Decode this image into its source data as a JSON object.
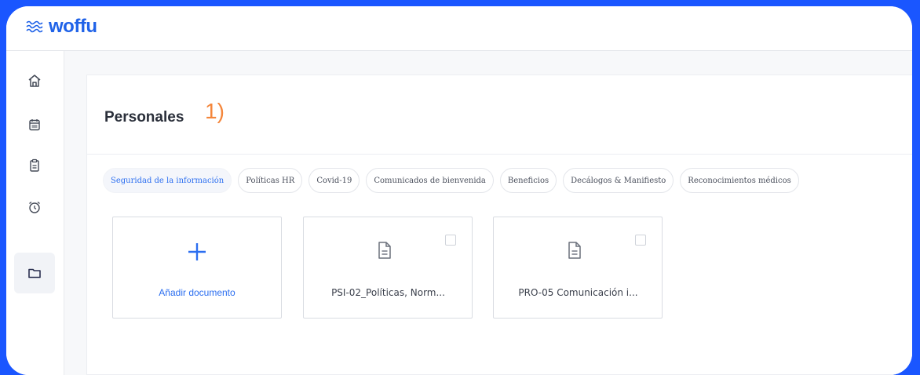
{
  "brand": {
    "logo_text": "woffu",
    "color": "#1f62e8"
  },
  "sidebar": {
    "items": [
      {
        "icon": "home-icon"
      },
      {
        "icon": "calendar-icon"
      },
      {
        "icon": "clipboard-icon"
      },
      {
        "icon": "alarm-clock-icon"
      },
      {
        "icon": "folder-icon",
        "active": true
      }
    ]
  },
  "page": {
    "title": "Personales",
    "annotation": "1)"
  },
  "tabs": [
    {
      "label": "Seguridad de la información",
      "active": true
    },
    {
      "label": "Políticas HR"
    },
    {
      "label": "Covid-19"
    },
    {
      "label": "Comunicados de bienvenida"
    },
    {
      "label": "Beneficios"
    },
    {
      "label": "Decálogos & Manifiesto"
    },
    {
      "label": "Reconocimientos médicos"
    }
  ],
  "documents": {
    "add_label": "Añadir documento",
    "items": [
      {
        "name": "PSI-02_Políticas, Norm..."
      },
      {
        "name": "PRO-05 Comunicación i..."
      }
    ]
  },
  "colors": {
    "frame_background": "#1a56ff",
    "accent": "#2b6ef0",
    "annotation": "#f4863b"
  }
}
